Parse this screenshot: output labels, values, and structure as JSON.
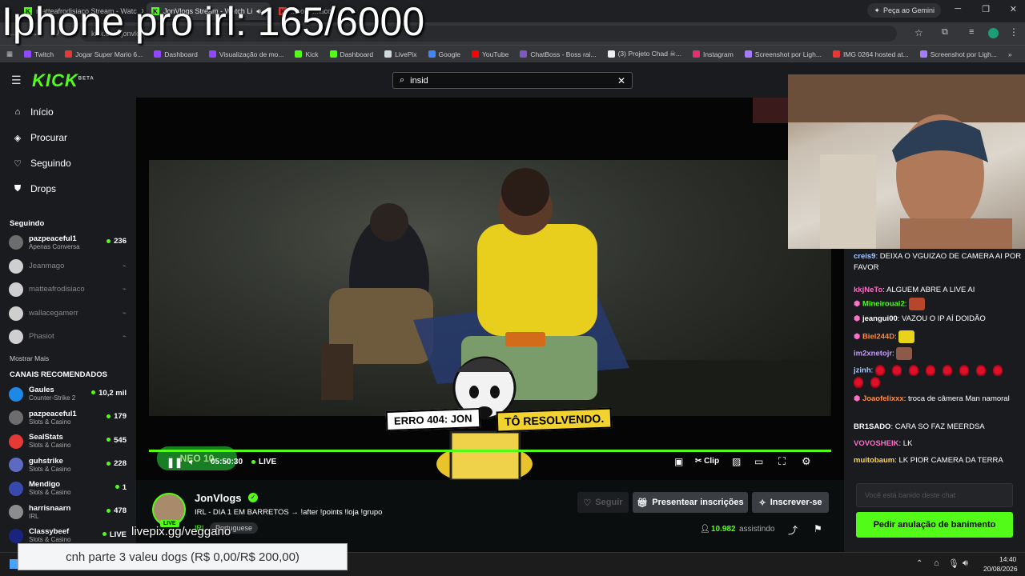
{
  "overlay": {
    "title": "Iphone pro irl: 165/6000",
    "pix_url": "livepix.gg/veggano",
    "donation": "cnh parte 3 valeu dogs (R$ 0,00/R$ 200,00)"
  },
  "browser": {
    "tabs": [
      {
        "label": "matteafrodisiaco Stream - Watc"
      },
      {
        "label": "JonVlogs Stream - Watch Li"
      },
      {
        "label": "...com ...iaco"
      }
    ],
    "gemini": "Peça ao Gemini",
    "url": "kick.com/jonvlogs",
    "bookmarks": [
      {
        "label": "Twitch",
        "color": "#9146ff"
      },
      {
        "label": "Jogar Super Mario 6...",
        "color": "#e53935"
      },
      {
        "label": "Dashboard",
        "color": "#9146ff"
      },
      {
        "label": "Visualização de mo...",
        "color": "#9146ff"
      },
      {
        "label": "Kick",
        "color": "#53fc18"
      },
      {
        "label": "Dashboard",
        "color": "#53fc18"
      },
      {
        "label": "LivePix",
        "color": "#cfd8dc"
      },
      {
        "label": "Google",
        "color": "#4285f4"
      },
      {
        "label": "YouTube",
        "color": "#ff0000"
      },
      {
        "label": "ChatBoss - Boss rai...",
        "color": "#7e57c2"
      },
      {
        "label": "(3) Projeto Chad ☠...",
        "color": "#eeeeee"
      },
      {
        "label": "Instagram",
        "color": "#e1306c"
      },
      {
        "label": "Screenshot por Ligh...",
        "color": "#a67cff"
      },
      {
        "label": "IMG 0264 hosted at...",
        "color": "#e53935"
      },
      {
        "label": "Screenshot por Ligh...",
        "color": "#a67cff"
      }
    ]
  },
  "search": {
    "value": "insid"
  },
  "sidebar": {
    "nav": [
      {
        "label": "Início",
        "icon": "home-icon",
        "glyph": "⌂"
      },
      {
        "label": "Procurar",
        "icon": "browse-icon",
        "glyph": "◈"
      },
      {
        "label": "Seguindo",
        "icon": "heart-icon",
        "glyph": "♡"
      },
      {
        "label": "Drops",
        "icon": "drops-icon",
        "glyph": "⛊"
      }
    ],
    "following_title": "Seguindo",
    "following": [
      {
        "name": "pazpeaceful1",
        "sub": "Apenas Conversa",
        "count": "236",
        "live": true,
        "color": "#6d6d6d"
      },
      {
        "name": "Jeanmago",
        "live": false,
        "color": "#cfcfcf"
      },
      {
        "name": "matteafrodisiaco",
        "live": false,
        "color": "#cfcfcf"
      },
      {
        "name": "wallacegamerr",
        "live": false,
        "color": "#cfcfcf"
      },
      {
        "name": "Phasiot",
        "live": false,
        "color": "#cfcfcf"
      }
    ],
    "show_more": "Mostrar Mais",
    "recommended_title": "CANAIS RECOMENDADOS",
    "recommended": [
      {
        "name": "Gaules",
        "sub": "Counter-Strike 2",
        "count": "10,2 mil",
        "color": "#1e88e5"
      },
      {
        "name": "pazpeaceful1",
        "sub": "Slots & Casino",
        "count": "179",
        "color": "#6d6d6d"
      },
      {
        "name": "SealStats",
        "sub": "Slots & Casino",
        "count": "545",
        "color": "#e53935"
      },
      {
        "name": "guhstrike",
        "sub": "Slots & Casino",
        "count": "228",
        "color": "#5c6bc0"
      },
      {
        "name": "Mendigo",
        "sub": "Slots & Casino",
        "count": "1",
        "color": "#3949ab"
      },
      {
        "name": "harrisnaarn",
        "sub": "IRL",
        "count": "478",
        "color": "#8d8d8d"
      },
      {
        "name": "Classybeef",
        "sub": "Slots & Casino",
        "count": "LIVE",
        "color": "#1a237e"
      }
    ]
  },
  "video": {
    "time": "05:50:30",
    "live": "LIVE",
    "clip": "Clip",
    "banner_left": "ERRO 404: JON",
    "banner_right": "TÔ RESOLVENDO.",
    "badge": "NEO 10"
  },
  "channel": {
    "name": "JonVlogs",
    "title": "IRL - DIA 1 EM BARRETOS → !after !points !loja !grupo",
    "category": "IRL",
    "language": "Portuguese",
    "live_badge": "LIVE",
    "viewers": "10.982",
    "viewers_label": "assistindo",
    "follow": "Seguir",
    "gift": "Presentear inscrições",
    "subscribe": "Inscrever-se"
  },
  "chat": {
    "messages": [
      {
        "user": "creis9",
        "color": "#a7c8ff",
        "text": "DEIXA O VGUIZAO DE CAMERA AI POR FAVOR",
        "badge": false
      },
      {
        "user": "kkjNeTo",
        "color": "#ff6ec7",
        "text": "ALGUEM ABRE A LIVE AI",
        "badge": false
      },
      {
        "user": "Mineirouai2",
        "color": "#53fc18",
        "text": "",
        "badge": true,
        "emote": "#b7472a"
      },
      {
        "user": "jeangui00",
        "color": "#ffffff",
        "text": "VAZOU O IP AÍ DOIDÃO",
        "badge": true
      },
      {
        "user": "Biel244D",
        "color": "#ff8a3d",
        "text": "",
        "badge": true,
        "emote": "#e8d21a"
      },
      {
        "user": "im2xnetojr",
        "color": "#c79bff",
        "text": "",
        "badge": false,
        "emote": "#8d5a4a"
      },
      {
        "user": "jzinh",
        "color": "#a7c8ff",
        "text": "",
        "badge": false,
        "roses": 10
      },
      {
        "user": "Joaofelixxx",
        "color": "#ff8a3d",
        "text": "troca de câmera Man namoral",
        "badge": true
      },
      {
        "user": "BR1SADO",
        "color": "#ffffff",
        "text": "CARA SO FAZ MEERDSA",
        "badge": false
      },
      {
        "user": "VOVOSHEIK",
        "color": "#ff6ec7",
        "text": "LK",
        "badge": false
      },
      {
        "user": "muitobaum",
        "color": "#ffd54f",
        "text": "LK PIOR CAMERA DA TERRA",
        "badge": false
      }
    ],
    "input_placeholder": "Você está banido deste chat",
    "ban_button": "Pedir anulação de banimento"
  },
  "taskbar": {
    "time": "14:40",
    "date": "20/08/2026"
  }
}
